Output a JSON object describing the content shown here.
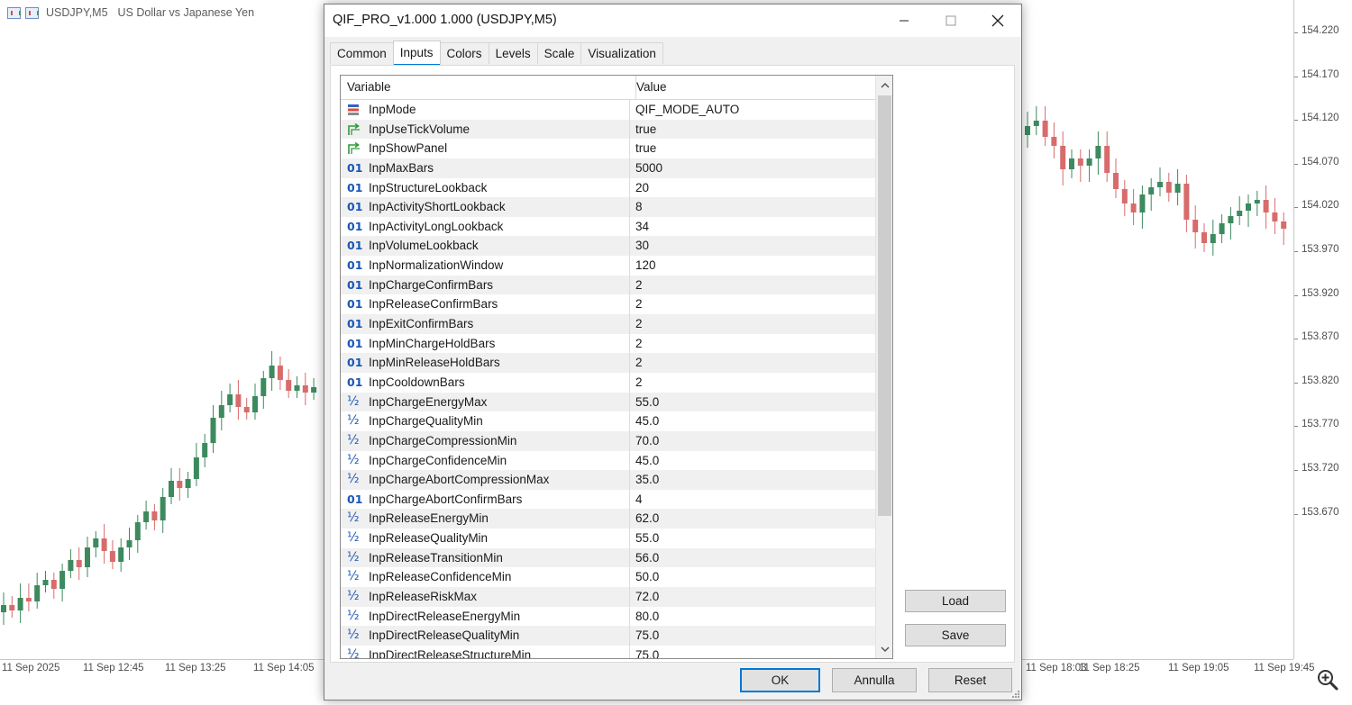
{
  "chart": {
    "symbol_label": "USDJPY,M5",
    "description": "US Dollar vs Japanese Yen",
    "price_labels": [
      "154.220",
      "154.170",
      "154.120",
      "154.070",
      "154.020",
      "153.970",
      "153.920",
      "153.870",
      "153.820",
      "153.770",
      "153.720",
      "153.670"
    ],
    "time_labels": [
      "11 Sep 2025",
      "11 Sep 12:45",
      "11 Sep 13:25",
      "11 Sep 14:05",
      "11 Sep 18:03",
      "11 Sep 18:25",
      "11 Sep 19:05",
      "11 Sep 19:45"
    ],
    "bull_color": "#3c8a5e",
    "bear_color": "#d86b6b",
    "zoom_icon": "magnifier-plus-icon"
  },
  "dialog": {
    "title": "QIF_PRO_v1.000 1.000 (USDJPY,M5)",
    "tabs": [
      {
        "label": "Common"
      },
      {
        "label": "Inputs",
        "active": true
      },
      {
        "label": "Colors"
      },
      {
        "label": "Levels"
      },
      {
        "label": "Scale"
      },
      {
        "label": "Visualization"
      }
    ],
    "columns": {
      "variable": "Variable",
      "value": "Value"
    },
    "type_glyphs": {
      "int": "01",
      "double": "½"
    },
    "rows": [
      {
        "type": "enum",
        "name": "InpMode",
        "value": "QIF_MODE_AUTO"
      },
      {
        "type": "bool",
        "name": "InpUseTickVolume",
        "value": "true"
      },
      {
        "type": "bool",
        "name": "InpShowPanel",
        "value": "true"
      },
      {
        "type": "int",
        "name": "InpMaxBars",
        "value": "5000"
      },
      {
        "type": "int",
        "name": "InpStructureLookback",
        "value": "20"
      },
      {
        "type": "int",
        "name": "InpActivityShortLookback",
        "value": "8"
      },
      {
        "type": "int",
        "name": "InpActivityLongLookback",
        "value": "34"
      },
      {
        "type": "int",
        "name": "InpVolumeLookback",
        "value": "30"
      },
      {
        "type": "int",
        "name": "InpNormalizationWindow",
        "value": "120"
      },
      {
        "type": "int",
        "name": "InpChargeConfirmBars",
        "value": "2"
      },
      {
        "type": "int",
        "name": "InpReleaseConfirmBars",
        "value": "2"
      },
      {
        "type": "int",
        "name": "InpExitConfirmBars",
        "value": "2"
      },
      {
        "type": "int",
        "name": "InpMinChargeHoldBars",
        "value": "2"
      },
      {
        "type": "int",
        "name": "InpMinReleaseHoldBars",
        "value": "2"
      },
      {
        "type": "int",
        "name": "InpCooldownBars",
        "value": "2"
      },
      {
        "type": "double",
        "name": "InpChargeEnergyMax",
        "value": "55.0"
      },
      {
        "type": "double",
        "name": "InpChargeQualityMin",
        "value": "45.0"
      },
      {
        "type": "double",
        "name": "InpChargeCompressionMin",
        "value": "70.0"
      },
      {
        "type": "double",
        "name": "InpChargeConfidenceMin",
        "value": "45.0"
      },
      {
        "type": "double",
        "name": "InpChargeAbortCompressionMax",
        "value": "35.0"
      },
      {
        "type": "int",
        "name": "InpChargeAbortConfirmBars",
        "value": "4"
      },
      {
        "type": "double",
        "name": "InpReleaseEnergyMin",
        "value": "62.0"
      },
      {
        "type": "double",
        "name": "InpReleaseQualityMin",
        "value": "55.0"
      },
      {
        "type": "double",
        "name": "InpReleaseTransitionMin",
        "value": "56.0"
      },
      {
        "type": "double",
        "name": "InpReleaseConfidenceMin",
        "value": "50.0"
      },
      {
        "type": "double",
        "name": "InpReleaseRiskMax",
        "value": "72.0"
      },
      {
        "type": "double",
        "name": "InpDirectReleaseEnergyMin",
        "value": "80.0"
      },
      {
        "type": "double",
        "name": "InpDirectReleaseQualityMin",
        "value": "75.0"
      },
      {
        "type": "double",
        "name": "InpDirectReleaseStructureMin",
        "value": "75.0"
      }
    ],
    "side_buttons": {
      "load": "Load",
      "save": "Save"
    },
    "buttons": {
      "ok": "OK",
      "cancel": "Annulla",
      "reset": "Reset"
    }
  }
}
